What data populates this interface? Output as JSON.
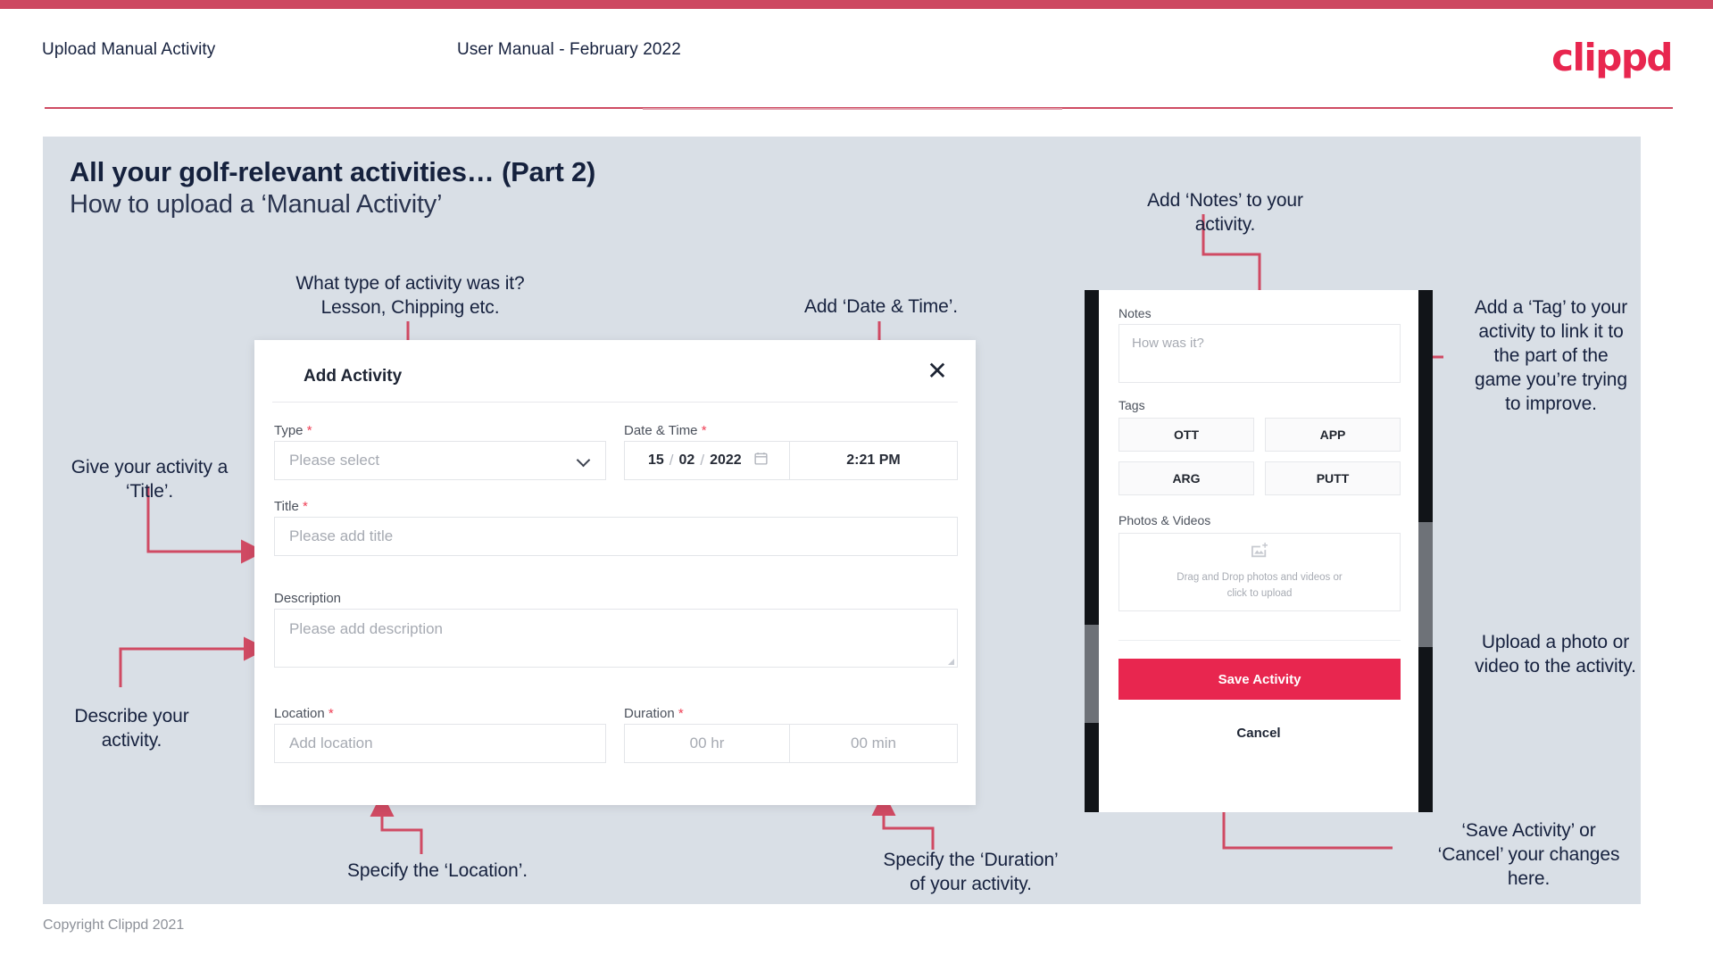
{
  "header": {
    "left_title": "Upload Manual Activity",
    "center_title": "User Manual - February 2022",
    "logo": "clippd"
  },
  "slide": {
    "title": "All your golf-relevant activities… (Part 2)",
    "subtitle": "How to upload a ‘Manual Activity’"
  },
  "footer": {
    "copyright": "Copyright Clippd 2021"
  },
  "dialog": {
    "title": "Add Activity",
    "close_icon": "close-icon",
    "fields": {
      "type": {
        "label": "Type",
        "required": "*",
        "placeholder": "Please select",
        "caret_icon": "chevron-down-icon"
      },
      "datetime": {
        "label": "Date & Time",
        "required": "*",
        "day": "15",
        "sep1": "/",
        "month": "02",
        "sep2": "/",
        "year": "2022",
        "calendar_icon": "calendar-icon",
        "time": "2:21 PM"
      },
      "title": {
        "label": "Title",
        "required": "*",
        "placeholder": "Please add title"
      },
      "description": {
        "label": "Description",
        "required": "",
        "placeholder": "Please add description"
      },
      "location": {
        "label": "Location",
        "required": "*",
        "placeholder": "Add location"
      },
      "duration": {
        "label": "Duration",
        "required": "*",
        "hours_placeholder": "00 hr",
        "minutes_placeholder": "00 min"
      }
    }
  },
  "phone": {
    "notes": {
      "label": "Notes",
      "placeholder": "How was it?"
    },
    "tags": {
      "label": "Tags",
      "items": [
        "OTT",
        "APP",
        "ARG",
        "PUTT"
      ]
    },
    "photos": {
      "label": "Photos & Videos",
      "icon": "image-add-icon",
      "hint_line1": "Drag and Drop photos and videos or",
      "hint_line2": "click to upload"
    },
    "save_label": "Save Activity",
    "cancel_label": "Cancel"
  },
  "annotations": {
    "type": "What type of activity was it?\nLesson, Chipping etc.",
    "datetime": "Add ‘Date & Time’.",
    "title": "Give your activity a\n‘Title’.",
    "description": "Describe your\nactivity.",
    "location": "Specify the ‘Location’.",
    "duration": "Specify the ‘Duration’\nof your activity.",
    "notes": "Add ‘Notes’ to your\nactivity.",
    "tags": "Add a ‘Tag’ to your\nactivity to link it to\nthe part of the\ngame you’re trying\nto improve.",
    "upload": "Upload a photo or\nvideo to the activity.",
    "save": "‘Save Activity’ or\n‘Cancel’ your changes\nhere."
  },
  "colors": {
    "brand_red": "#e8264f",
    "bar_red": "#cd4861",
    "arrow_red": "#d04a63",
    "slide_bg": "#d9dfe6",
    "ink": "#16213e"
  }
}
